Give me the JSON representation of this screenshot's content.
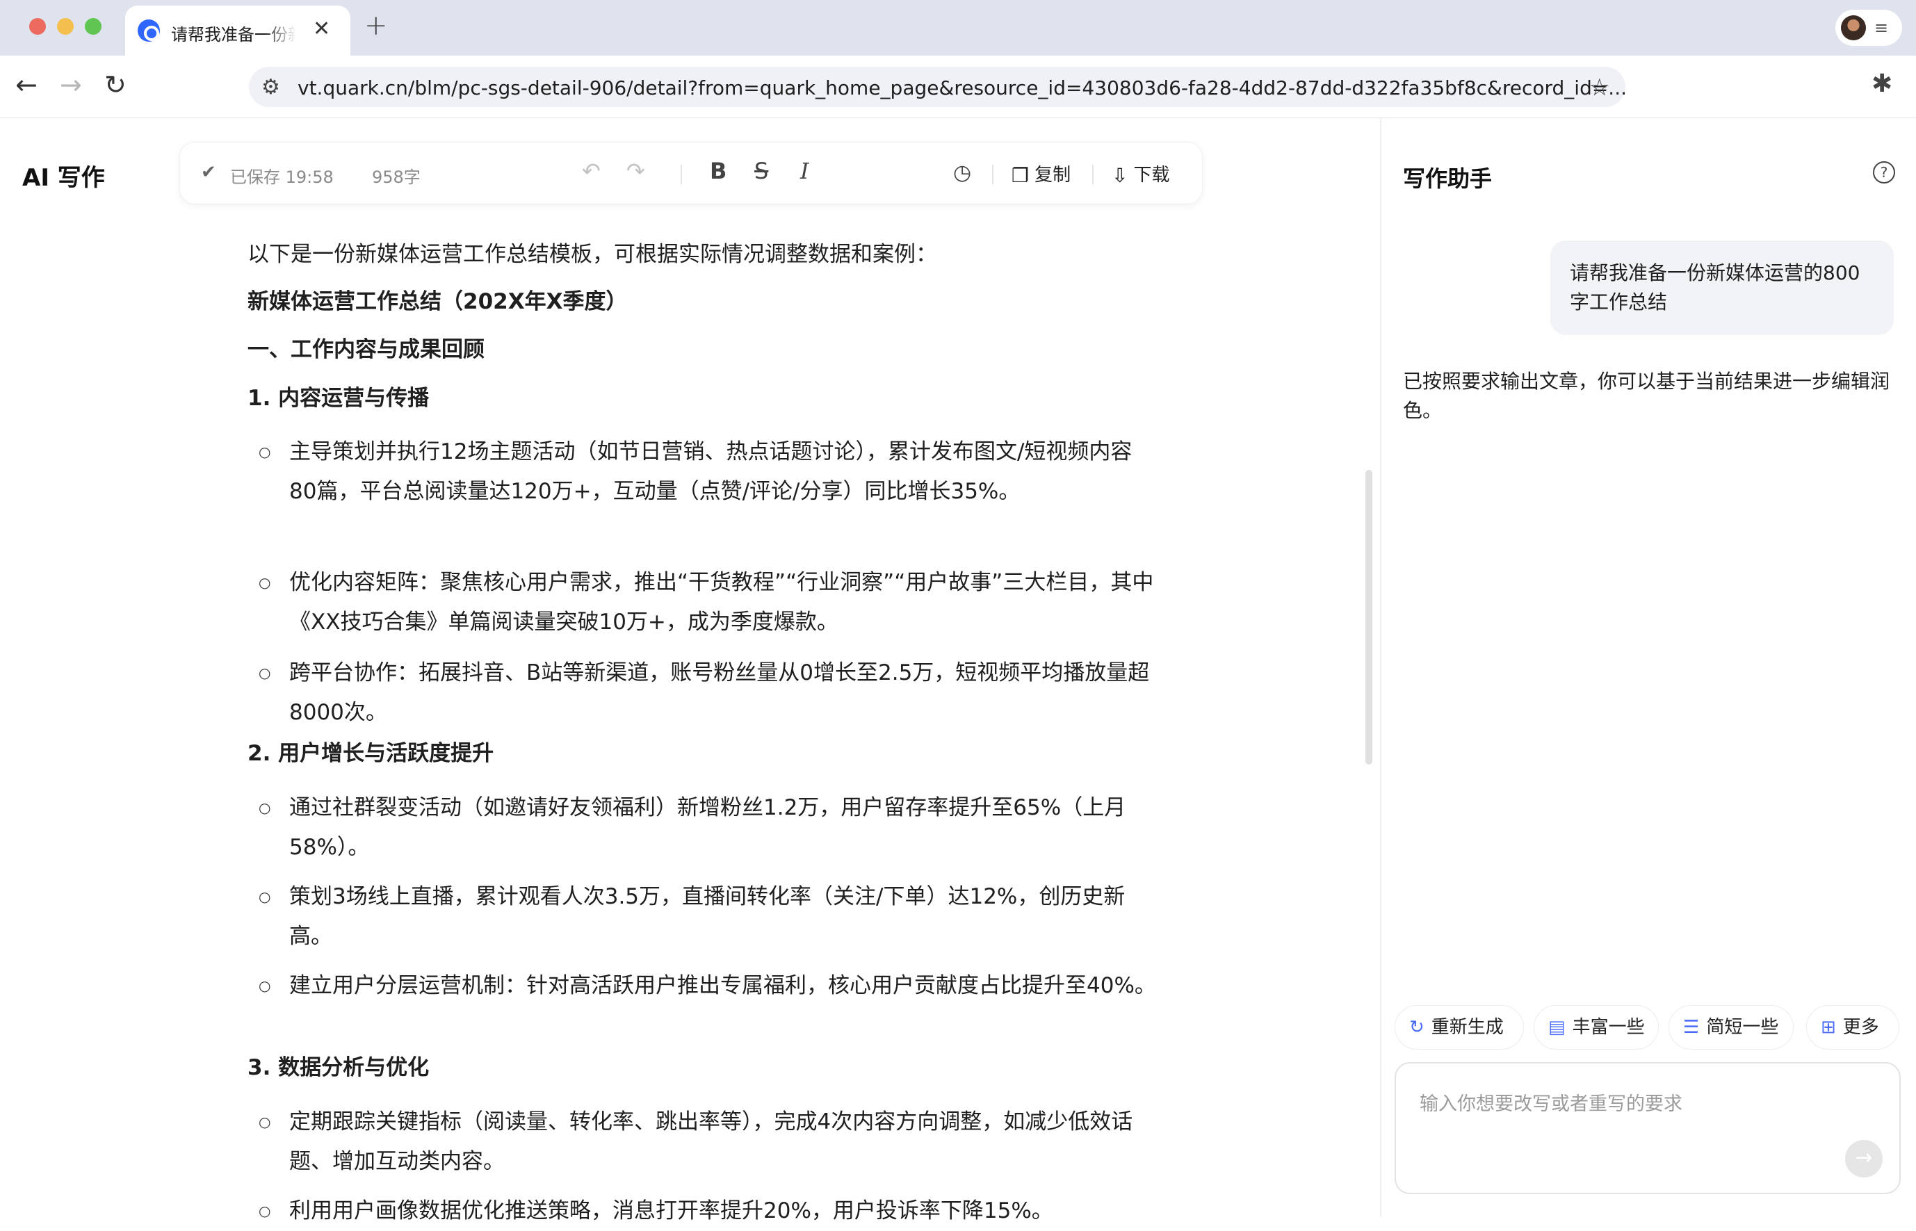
{
  "browser": {
    "tab_title": "请帮我准备一份新",
    "tab_close": "✕",
    "new_tab": "+",
    "url": "vt.quark.cn/blm/pc-sgs-detail-906/detail?from=quark_home_page&resource_id=430803d6-fa28-4dd2-87dd-d322fa35bf8c&record_id=...",
    "icons": [
      "close-window",
      "minimize-window",
      "maximize-window",
      "favicon",
      "back-arrow",
      "forward-arrow",
      "reload",
      "site-info",
      "bookmark-star",
      "extensions-puzzle",
      "avatar",
      "menu"
    ]
  },
  "app": {
    "logo": "AI 写作"
  },
  "editor_toolbar": {
    "saved_status": "已保存 19:58",
    "word_count": "958字",
    "copy_label": "复制",
    "download_label": "下载",
    "icons": [
      "check",
      "undo",
      "redo",
      "bold",
      "strikethrough",
      "italic",
      "history",
      "copy",
      "download"
    ]
  },
  "document": {
    "intro": "以下是一份新媒体运营工作总结模板，可根据实际情况调整数据和案例：",
    "title": "新媒体运营工作总结（202X年X季度）",
    "section1": "一、工作内容与成果回顾",
    "sub1": "1. 内容运营与传播",
    "sub1_items": [
      "主导策划并执行12场主题活动（如节日营销、热点话题讨论），累计发布图文/短视频内容80篇，平台总阅读量达120万+，互动量（点赞/评论/分享）同比增长35%。",
      "优化内容矩阵：聚焦核心用户需求，推出“干货教程”“行业洞察”“用户故事”三大栏目，其中《XX技巧合集》单篇阅读量突破10万+，成为季度爆款。",
      "跨平台协作：拓展抖音、B站等新渠道，账号粉丝量从0增长至2.5万，短视频平均播放量超8000次。"
    ],
    "sub2": "2. 用户增长与活跃度提升",
    "sub2_items": [
      "通过社群裂变活动（如邀请好友领福利）新增粉丝1.2万，用户留存率提升至65%（上月58%）。",
      "策划3场线上直播，累计观看人次3.5万，直播间转化率（关注/下单）达12%，创历史新高。",
      "建立用户分层运营机制：针对高活跃用户推出专属福利，核心用户贡献度占比提升至40%。"
    ],
    "sub3": "3. 数据分析与优化",
    "sub3_items": [
      "定期跟踪关键指标（阅读量、转化率、跳出率等），完成4次内容方向调整，如减少低效话题、增加互动类内容。",
      "利用用户画像数据优化推送策略，消息打开率提升20%，用户投诉率下降15%。"
    ]
  },
  "assistant": {
    "title": "写作助手",
    "help": "?",
    "user_message": "请帮我准备一份新媒体运营的800字工作总结",
    "reply": "已按照要求输出文章，你可以基于当前结果进一步编辑润色。",
    "chips": [
      "重新生成",
      "丰富一些",
      "简短一些",
      "更多"
    ],
    "input_placeholder": "输入你想要改写或者重写的要求",
    "send": "→"
  }
}
